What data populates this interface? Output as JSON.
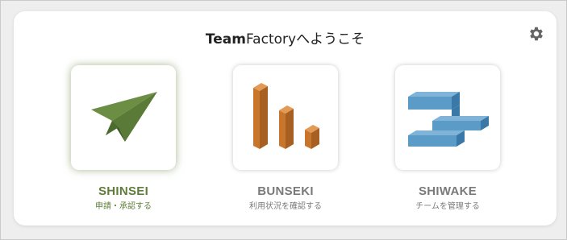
{
  "header": {
    "title_bold": "Team",
    "title_rest": "Factoryへようこそ"
  },
  "settings": {
    "icon": "gear-icon"
  },
  "apps": [
    {
      "name": "SHINSEI",
      "subtitle": "申請・承認する",
      "icon": "paper-plane-icon",
      "color": "#5f7d3a",
      "active": true
    },
    {
      "name": "BUNSEKI",
      "subtitle": "利用状況を確認する",
      "icon": "bar-chart-icon",
      "color": "#7a7a7a",
      "active": false
    },
    {
      "name": "SHIWAKE",
      "subtitle": "チームを管理する",
      "icon": "sorting-blocks-icon",
      "color": "#7a7a7a",
      "active": false
    }
  ]
}
